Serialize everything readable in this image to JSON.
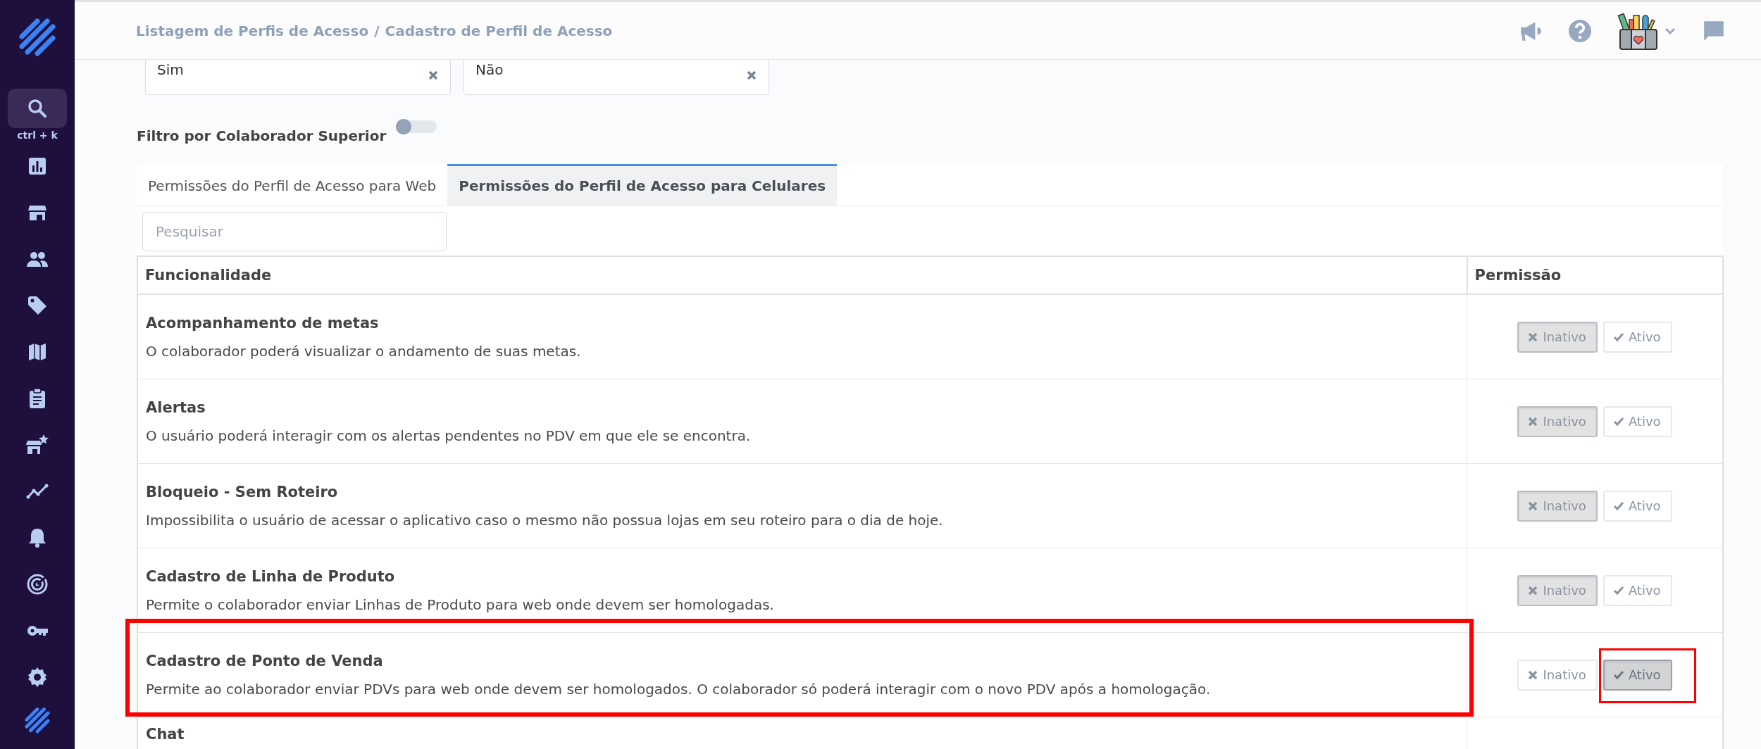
{
  "sidebar": {
    "items": [
      {
        "kind": "search",
        "selected": true,
        "shortcut": "ctrl + k"
      },
      {
        "kind": "chart",
        "selected": false
      },
      {
        "kind": "store",
        "selected": false
      },
      {
        "kind": "people",
        "selected": false
      },
      {
        "kind": "tag",
        "selected": false
      },
      {
        "kind": "map",
        "selected": false
      },
      {
        "kind": "clipboard",
        "selected": false
      },
      {
        "kind": "store-star",
        "selected": false
      },
      {
        "kind": "trend",
        "selected": false
      },
      {
        "kind": "bell",
        "selected": false
      },
      {
        "kind": "radar",
        "selected": false
      },
      {
        "kind": "key",
        "selected": false
      },
      {
        "kind": "gear",
        "selected": false
      }
    ]
  },
  "breadcrumb": [
    "Listagem de Perfis de Acesso",
    "/",
    "Cadastro de Perfil de Acesso"
  ],
  "select_fields": [
    {
      "value": "Sim"
    },
    {
      "value": "Não"
    }
  ],
  "filter": {
    "label": "Filtro por Colaborador Superior",
    "on": false
  },
  "tabs": [
    {
      "label": "Permissões do Perfil de Acesso para Web",
      "selected": false
    },
    {
      "label": "Permissões do Perfil de Acesso para Celulares",
      "selected": true
    }
  ],
  "search": {
    "placeholder": "Pesquisar"
  },
  "table": {
    "columns": [
      "Funcionalidade",
      "Permissão"
    ],
    "rows": [
      {
        "title": "Acompanhamento de metas",
        "description": "O colaborador poderá visualizar o andamento de suas metas.",
        "highlighted": false,
        "options": [
          {
            "label": "Inativo",
            "kind": "off",
            "selected": true,
            "highlighted": false
          },
          {
            "label": "Ativo",
            "kind": "on",
            "selected": false,
            "highlighted": false
          }
        ]
      },
      {
        "title": "Alertas",
        "description": "O usuário poderá interagir com os alertas pendentes no PDV em que ele se encontra.",
        "highlighted": false,
        "options": [
          {
            "label": "Inativo",
            "kind": "off",
            "selected": true,
            "highlighted": false
          },
          {
            "label": "Ativo",
            "kind": "on",
            "selected": false,
            "highlighted": false
          }
        ]
      },
      {
        "title": "Bloqueio - Sem Roteiro",
        "description": "Impossibilita o usuário de acessar o aplicativo caso o mesmo não possua lojas em seu roteiro para o dia de hoje.",
        "highlighted": false,
        "options": [
          {
            "label": "Inativo",
            "kind": "off",
            "selected": true,
            "highlighted": false
          },
          {
            "label": "Ativo",
            "kind": "on",
            "selected": false,
            "highlighted": false
          }
        ]
      },
      {
        "title": "Cadastro de Linha de Produto",
        "description": "Permite o colaborador enviar Linhas de Produto para web onde devem ser homologadas.",
        "highlighted": false,
        "options": [
          {
            "label": "Inativo",
            "kind": "off",
            "selected": true,
            "highlighted": false
          },
          {
            "label": "Ativo",
            "kind": "on",
            "selected": false,
            "highlighted": false
          }
        ]
      },
      {
        "title": "Cadastro de Ponto de Venda",
        "description": "Permite ao colaborador enviar PDVs para web onde devem ser homologados. O colaborador só poderá interagir com o novo PDV após a homologação.",
        "highlighted": true,
        "options": [
          {
            "label": "Inativo",
            "kind": "off",
            "selected": false,
            "highlighted": false
          },
          {
            "label": "Ativo",
            "kind": "on",
            "selected": true,
            "highlighted": true
          }
        ]
      },
      {
        "title": "Chat",
        "highlighted": false
      }
    ]
  }
}
